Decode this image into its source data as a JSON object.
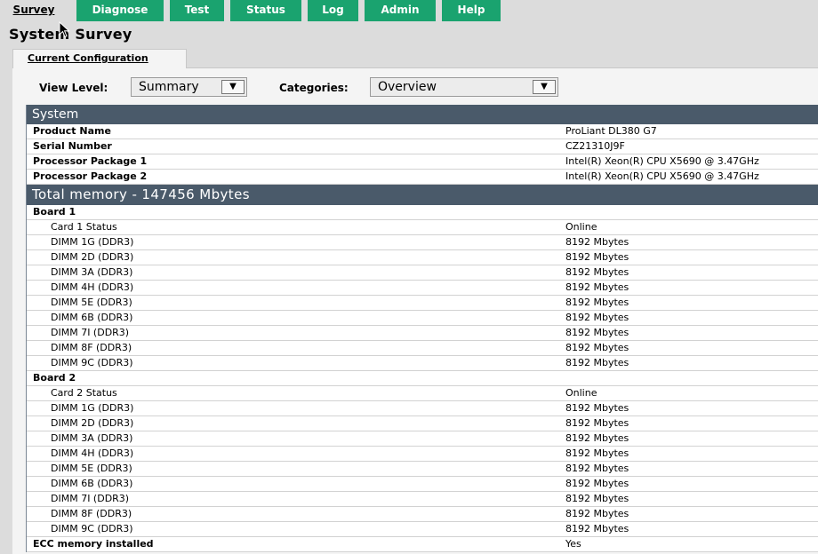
{
  "nav": {
    "tabs": [
      {
        "label": "Survey"
      },
      {
        "label": "Diagnose"
      },
      {
        "label": "Test"
      },
      {
        "label": "Status"
      },
      {
        "label": "Log"
      },
      {
        "label": "Admin"
      },
      {
        "label": "Help"
      }
    ],
    "active_color": "#dcdcdc",
    "tab_color": "#1aa36f"
  },
  "page_title": "System Survey",
  "subtab_label": "Current Configuration",
  "controls": {
    "view_level_label": "View Level:",
    "view_level_value": "Summary",
    "categories_label": "Categories:",
    "categories_value": "Overview"
  },
  "system": {
    "header": "System",
    "rows": [
      {
        "key": "Product Name",
        "value": "ProLiant DL380 G7"
      },
      {
        "key": "Serial Number",
        "value": "CZ21310J9F"
      },
      {
        "key": "Processor Package 1",
        "value": "Intel(R) Xeon(R) CPU X5690 @ 3.47GHz"
      },
      {
        "key": "Processor Package 2",
        "value": "Intel(R) Xeon(R) CPU X5690 @ 3.47GHz"
      }
    ]
  },
  "memory": {
    "header": "Total memory - 147456 Mbytes",
    "board1": {
      "label": "Board 1",
      "rows": [
        {
          "key": "Card 1 Status",
          "value": "Online"
        },
        {
          "key": "DIMM 1G (DDR3)",
          "value": "8192 Mbytes"
        },
        {
          "key": "DIMM 2D (DDR3)",
          "value": "8192 Mbytes"
        },
        {
          "key": "DIMM 3A (DDR3)",
          "value": "8192 Mbytes"
        },
        {
          "key": "DIMM 4H (DDR3)",
          "value": "8192 Mbytes"
        },
        {
          "key": "DIMM 5E (DDR3)",
          "value": "8192 Mbytes"
        },
        {
          "key": "DIMM 6B (DDR3)",
          "value": "8192 Mbytes"
        },
        {
          "key": "DIMM 7I (DDR3)",
          "value": "8192 Mbytes"
        },
        {
          "key": "DIMM 8F (DDR3)",
          "value": "8192 Mbytes"
        },
        {
          "key": "DIMM 9C (DDR3)",
          "value": "8192 Mbytes"
        }
      ]
    },
    "board2": {
      "label": "Board 2",
      "rows": [
        {
          "key": "Card 2 Status",
          "value": "Online"
        },
        {
          "key": "DIMM 1G (DDR3)",
          "value": "8192 Mbytes"
        },
        {
          "key": "DIMM 2D (DDR3)",
          "value": "8192 Mbytes"
        },
        {
          "key": "DIMM 3A (DDR3)",
          "value": "8192 Mbytes"
        },
        {
          "key": "DIMM 4H (DDR3)",
          "value": "8192 Mbytes"
        },
        {
          "key": "DIMM 5E (DDR3)",
          "value": "8192 Mbytes"
        },
        {
          "key": "DIMM 6B (DDR3)",
          "value": "8192 Mbytes"
        },
        {
          "key": "DIMM 7I (DDR3)",
          "value": "8192 Mbytes"
        },
        {
          "key": "DIMM 8F (DDR3)",
          "value": "8192 Mbytes"
        },
        {
          "key": "DIMM 9C (DDR3)",
          "value": "8192 Mbytes"
        }
      ]
    },
    "ecc": {
      "key": "ECC memory installed",
      "value": "Yes"
    }
  },
  "dropdown_icon": "caret-down-icon",
  "header_color": "#4a5a6a"
}
